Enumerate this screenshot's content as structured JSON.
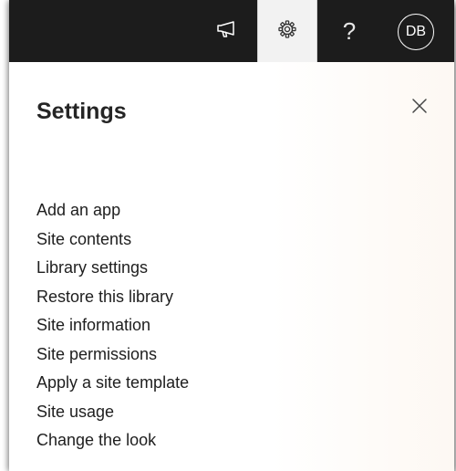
{
  "header": {
    "user_initials": "DB",
    "help_glyph": "?",
    "icons": {
      "feedback": "megaphone-icon",
      "settings": "gear-icon",
      "help": "question-mark-icon"
    }
  },
  "settings_panel": {
    "title": "Settings",
    "close_icon": "close-icon",
    "items": [
      {
        "label": "Add an app"
      },
      {
        "label": "Site contents"
      },
      {
        "label": "Library settings"
      },
      {
        "label": "Restore this library"
      },
      {
        "label": "Site information"
      },
      {
        "label": "Site permissions"
      },
      {
        "label": "Apply a site template"
      },
      {
        "label": "Site usage"
      },
      {
        "label": "Change the look"
      }
    ]
  },
  "colors": {
    "topbar": "#1c1c1c",
    "active_button": "#f2f2f2",
    "text": "#1e1e1e"
  }
}
